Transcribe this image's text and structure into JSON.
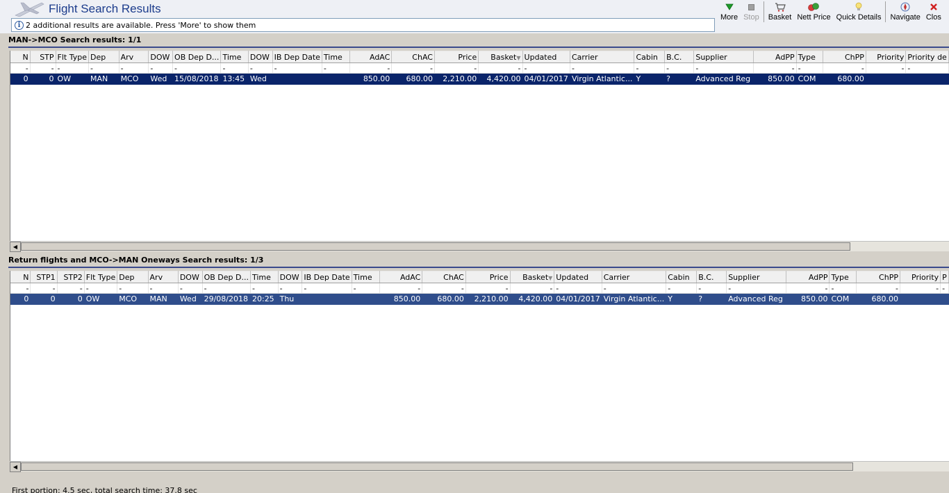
{
  "window": {
    "title": "Flight Search Results"
  },
  "info": {
    "message": "2 additional results are available. Press 'More' to show them"
  },
  "toolbar": {
    "more": "More",
    "stop": "Stop",
    "basket": "Basket",
    "nett_price": "Nett Price",
    "quick_details": "Quick Details",
    "navigate": "Navigate",
    "close": "Clos"
  },
  "outbound": {
    "title": "MAN->MCO Search results: 1/1",
    "columns": [
      "N",
      "STP",
      "Flt Type",
      "Dep",
      "Arv",
      "DOW",
      "OB Dep D...",
      "Time",
      "DOW",
      "IB Dep Date",
      "Time",
      "AdAC",
      "ChAC",
      "Price",
      "Basket",
      "Updated",
      "Carrier",
      "Cabin",
      "B.C.",
      "Supplier",
      "AdPP",
      "Type",
      "ChPP",
      "Priority",
      "Priority de"
    ],
    "filter": [
      "-",
      "-",
      "-",
      "-",
      "-",
      "-",
      "-",
      "-",
      "-",
      "-",
      "-",
      "-",
      "-",
      "-",
      "-",
      "-",
      "-",
      "-",
      "-",
      "-",
      "-",
      "-",
      "-",
      "-",
      "-"
    ],
    "row": [
      "0",
      "0",
      "OW",
      "MAN",
      "MCO",
      "Wed",
      "15/08/2018",
      "13:45",
      "Wed",
      "",
      "",
      "850.00",
      "680.00",
      "2,210.00",
      "4,420.00",
      "04/01/2017",
      "Virgin Atlantic...",
      "Y",
      "?",
      "Advanced Reg",
      "850.00",
      "COM",
      "680.00",
      "",
      ""
    ]
  },
  "return": {
    "title": "Return flights and MCO->MAN Oneways Search results: 1/3",
    "columns": [
      "N",
      "STP1",
      "STP2",
      "Flt Type",
      "Dep",
      "Arv",
      "DOW",
      "OB Dep D...",
      "Time",
      "DOW",
      "IB Dep Date",
      "Time",
      "AdAC",
      "ChAC",
      "Price",
      "Basket",
      "Updated",
      "Carrier",
      "Cabin",
      "B.C.",
      "Supplier",
      "AdPP",
      "Type",
      "ChPP",
      "Priority",
      "P"
    ],
    "filter": [
      "-",
      "-",
      "-",
      "-",
      "-",
      "-",
      "-",
      "-",
      "-",
      "-",
      "-",
      "-",
      "-",
      "-",
      "-",
      "-",
      "-",
      "-",
      "-",
      "-",
      "-",
      "-",
      "-",
      "-",
      "-",
      "-"
    ],
    "row": [
      "0",
      "0",
      "0",
      "OW",
      "MCO",
      "MAN",
      "Wed",
      "29/08/2018",
      "20:25",
      "Thu",
      "",
      "",
      "850.00",
      "680.00",
      "2,210.00",
      "4,420.00",
      "04/01/2017",
      "Virgin Atlantic...",
      "Y",
      "?",
      "Advanced Reg",
      "850.00",
      "COM",
      "680.00",
      "",
      ""
    ]
  },
  "status": {
    "text": "First portion: 4.5 sec, total search time: 37.8 sec"
  },
  "colors": {
    "title": "#1c3c8c",
    "selected_row": "#0a246a",
    "selected_row_inactive": "#2f4d8b",
    "rule": "#3a4a8c"
  }
}
